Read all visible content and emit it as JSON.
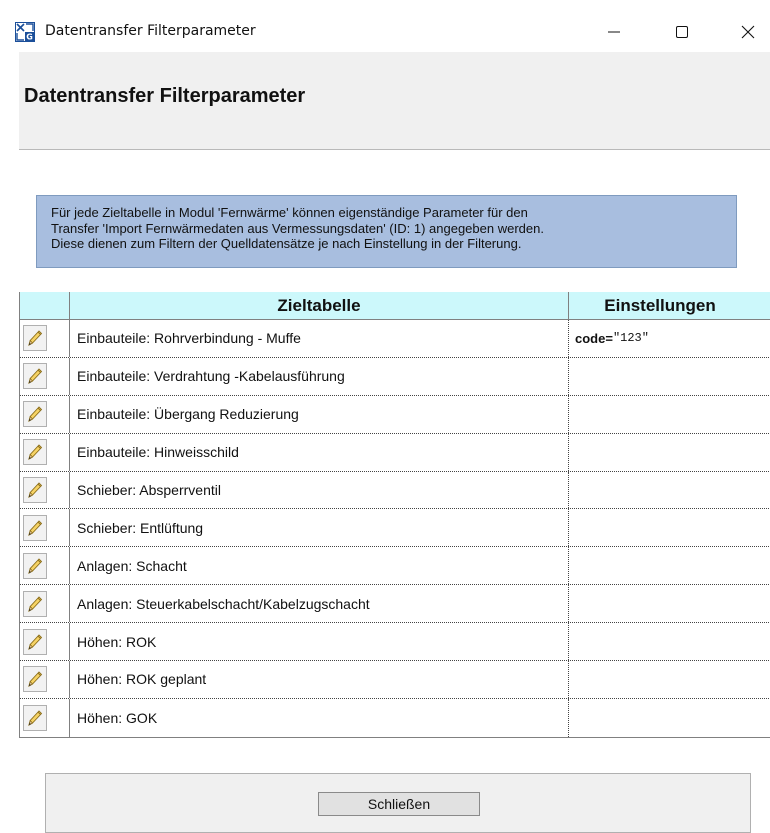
{
  "window": {
    "title": "Datentransfer Filterparameter",
    "icon": "kg-app-icon",
    "controls": [
      "minimize-icon",
      "maximize-icon",
      "close-icon"
    ]
  },
  "header": {
    "title": "Datentransfer Filterparameter"
  },
  "info": {
    "lines": [
      "Für jede Zieltabelle in Modul 'Fernwärme' können eigenständige Parameter für den",
      "Transfer 'Import Fernwärmedaten aus Vermessungsdaten' (ID: 1) angegeben werden.",
      "Diese dienen zum Filtern der Quelldatensätze je nach Einstellung in der Filterung."
    ],
    "background": "#a8bedf"
  },
  "table": {
    "header_background": "#ccf8fb",
    "columns": [
      "Zieltabelle",
      "Einstellungen"
    ],
    "rows": [
      {
        "zieltabelle": "Einbauteile: Rohrverbindung - Muffe",
        "einstellung_key": "code=",
        "einstellung_value": "\"123\""
      },
      {
        "zieltabelle": "Einbauteile: Verdrahtung -Kabelausführung",
        "einstellung_key": "",
        "einstellung_value": ""
      },
      {
        "zieltabelle": "Einbauteile: Übergang Reduzierung",
        "einstellung_key": "",
        "einstellung_value": ""
      },
      {
        "zieltabelle": "Einbauteile: Hinweisschild",
        "einstellung_key": "",
        "einstellung_value": ""
      },
      {
        "zieltabelle": "Schieber: Absperrventil",
        "einstellung_key": "",
        "einstellung_value": ""
      },
      {
        "zieltabelle": "Schieber: Entlüftung",
        "einstellung_key": "",
        "einstellung_value": ""
      },
      {
        "zieltabelle": "Anlagen: Schacht",
        "einstellung_key": "",
        "einstellung_value": ""
      },
      {
        "zieltabelle": "Anlagen: Steuerkabelschacht/Kabelzugschacht",
        "einstellung_key": "",
        "einstellung_value": ""
      },
      {
        "zieltabelle": "Höhen: ROK",
        "einstellung_key": "",
        "einstellung_value": ""
      },
      {
        "zieltabelle": "Höhen: ROK geplant",
        "einstellung_key": "",
        "einstellung_value": ""
      },
      {
        "zieltabelle": "Höhen: GOK",
        "einstellung_key": "",
        "einstellung_value": ""
      }
    ],
    "row_icon": "pencil-icon"
  },
  "footer": {
    "close_label": "Schließen"
  }
}
